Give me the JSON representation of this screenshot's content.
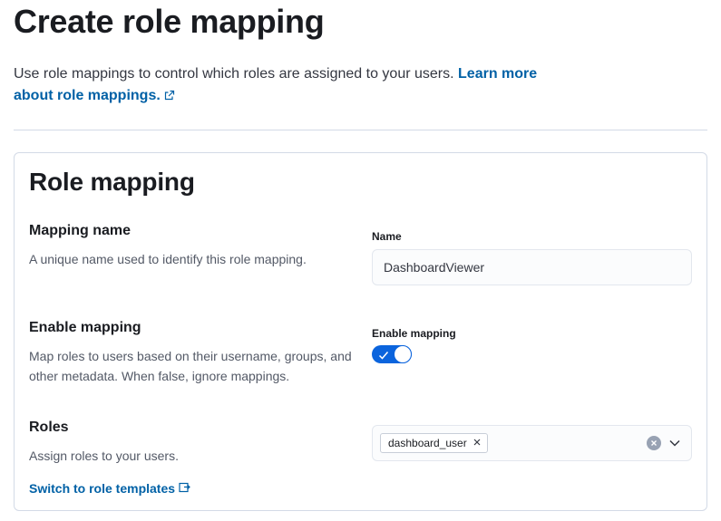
{
  "page": {
    "title": "Create role mapping",
    "intro_text": "Use role mappings to control which roles are assigned to your users. ",
    "learn_more_link": "Learn more about role mappings."
  },
  "panel": {
    "title": "Role mapping",
    "mapping_name": {
      "title": "Mapping name",
      "description": "A unique name used to identify this role mapping.",
      "field_label": "Name",
      "field_value": "DashboardViewer"
    },
    "enable_mapping": {
      "title": "Enable mapping",
      "description": "Map roles to users based on their username, groups, and other metadata. When false, ignore mappings.",
      "field_label": "Enable mapping",
      "enabled": true
    },
    "roles": {
      "title": "Roles",
      "description": "Assign roles to your users.",
      "selected_roles": [
        "dashboard_user"
      ],
      "switch_link": "Switch to role templates"
    }
  },
  "colors": {
    "accent": "#0b64dd",
    "link": "#0061a6",
    "border": "#d3dae6"
  },
  "icons": {
    "learn_more": "external-link-icon",
    "pill_remove": "close-icon",
    "clear": "clear-icon",
    "combo_open": "chevron-down-icon",
    "switch": "popout-icon",
    "toggle": "check-icon"
  }
}
